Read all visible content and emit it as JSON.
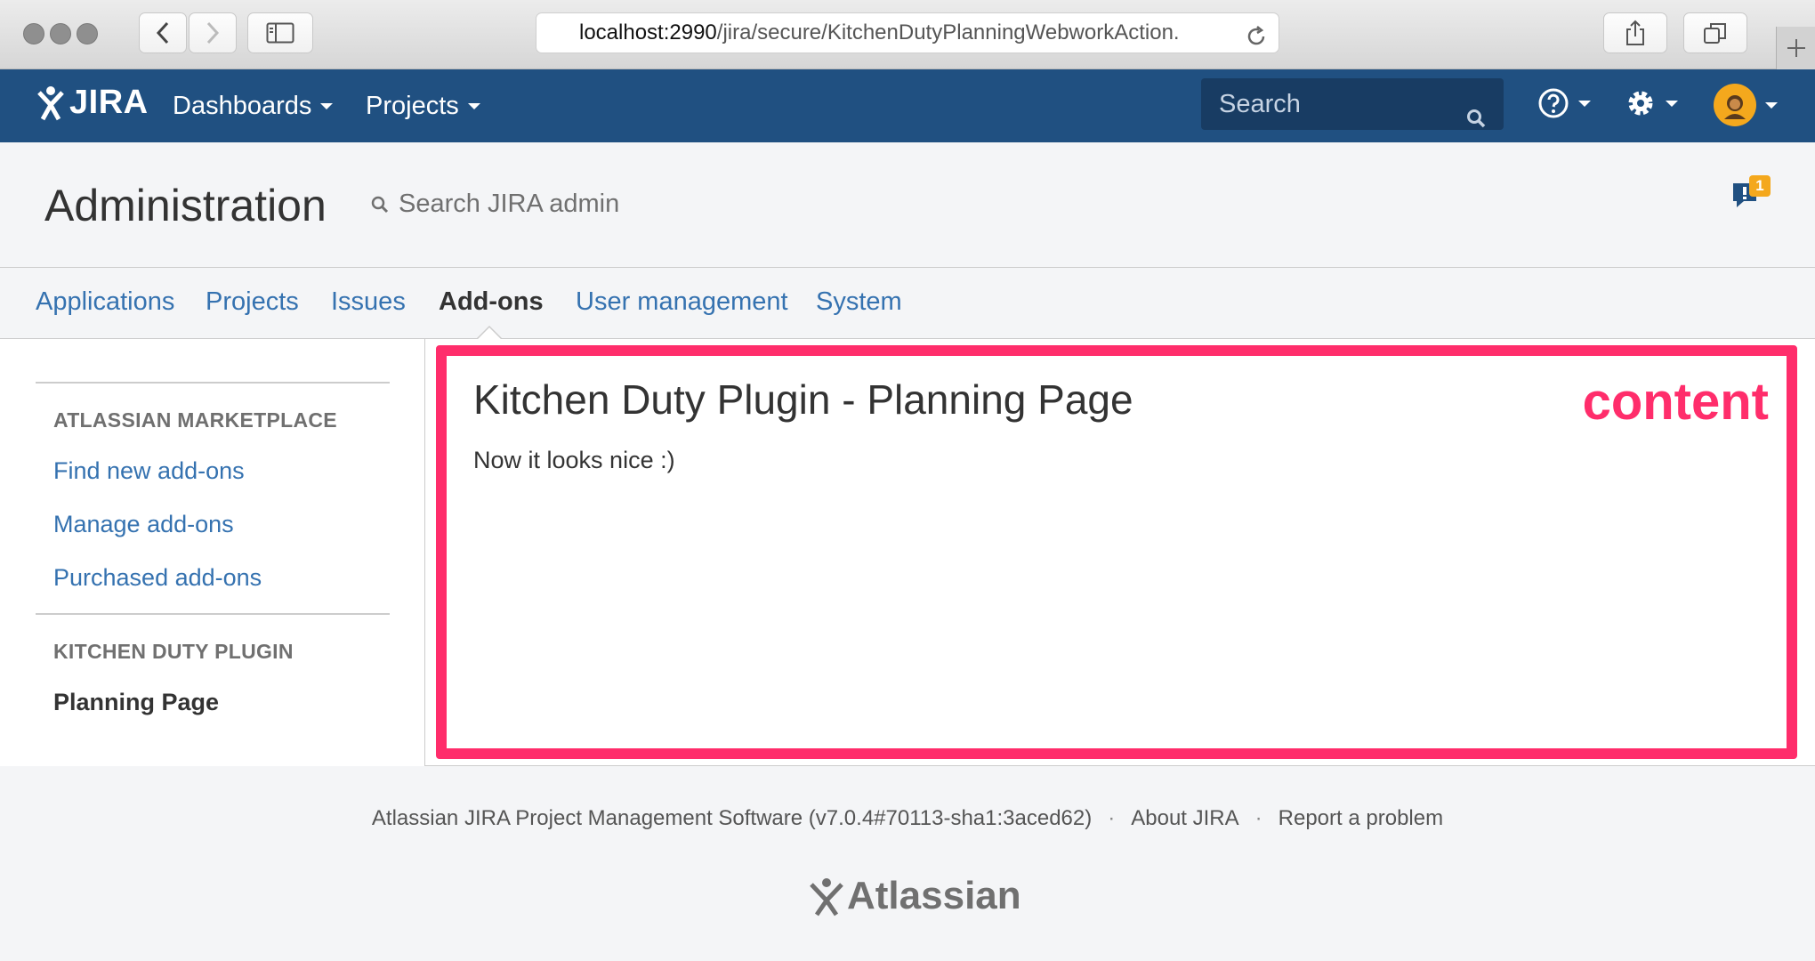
{
  "browser": {
    "url_host": "localhost:2990",
    "url_path": "/jira/secure/KitchenDutyPlanningWebworkAction.",
    "icons": [
      "close-dot",
      "minimize-dot",
      "zoom-dot",
      "back-icon",
      "forward-icon",
      "sidebar-icon",
      "reload-icon",
      "share-icon",
      "tabs-icon",
      "plus-icon"
    ]
  },
  "header": {
    "logo_text": "JIRA",
    "menus": [
      {
        "label": "Dashboards"
      },
      {
        "label": "Projects"
      }
    ],
    "search_placeholder": "Search",
    "icons": [
      "help-icon",
      "gear-icon",
      "avatar"
    ],
    "brand_color": "#205081"
  },
  "admin": {
    "title": "Administration",
    "search_label": "Search JIRA admin",
    "notification_count": "1",
    "tabs": [
      {
        "label": "Applications"
      },
      {
        "label": "Projects"
      },
      {
        "label": "Issues"
      },
      {
        "label": "Add-ons",
        "active": true
      },
      {
        "label": "User management"
      },
      {
        "label": "System"
      }
    ]
  },
  "sidebar": {
    "sections": [
      {
        "heading": "ATLASSIAN MARKETPLACE",
        "items": [
          {
            "label": "Find new add-ons"
          },
          {
            "label": "Manage add-ons"
          },
          {
            "label": "Purchased add-ons"
          }
        ]
      },
      {
        "heading": "KITCHEN DUTY PLUGIN",
        "items": [
          {
            "label": "Planning Page",
            "active": true
          }
        ]
      }
    ]
  },
  "content": {
    "title": "Kitchen Duty Plugin - Planning Page",
    "text": "Now it looks nice :)",
    "annotation": "content",
    "highlight_color": "#ff2d6b"
  },
  "footer": {
    "version_text": "Atlassian JIRA Project Management Software (v7.0.4#70113-sha1:3aced62)",
    "separator": "·",
    "about_label": "About JIRA",
    "report_label": "Report a problem",
    "logo_text": "Atlassian"
  }
}
